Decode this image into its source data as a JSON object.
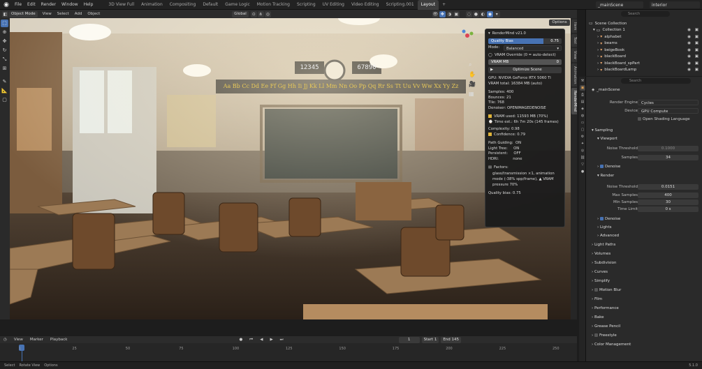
{
  "app": {
    "menu": [
      "File",
      "Edit",
      "Render",
      "Window",
      "Help"
    ],
    "workspaces": [
      "3D View Full",
      "Animation",
      "Compositing",
      "Default",
      "Game Logic",
      "Motion Tracking",
      "Scripting",
      "UV Editing",
      "Video Editing",
      "Scripting.001",
      "Layout"
    ],
    "active_workspace": "Layout",
    "scene_name": "_mainScene",
    "view_layer": "interior"
  },
  "viewport_header": {
    "mode": "Object Mode",
    "menus": [
      "View",
      "Select",
      "Add",
      "Object"
    ],
    "orientation": "Global",
    "options_label": "Options"
  },
  "scene_text": {
    "numbers_left": "12345",
    "numbers_right": "67890",
    "alphabet": "Aa Bb Cc Dd Ee Ff Gg Hh Ii Jj Kk Ll Mm Nn Oo Pp Qq Rr Ss Tt Uu Vv Ww Xx Yy Zz"
  },
  "right_tabs": [
    "Item",
    "Tool",
    "View",
    "Animation",
    "RenderMind"
  ],
  "rendermind": {
    "title": "RenderMind v21.0",
    "quality_label": "Quality Bias",
    "quality_value": "0.75",
    "quality_fraction": 0.75,
    "mode_label": "Mode:",
    "mode_value": "Balanced",
    "vram_override": "VRAM Override (0 = auto-detect)",
    "vram_mb_label": "VRAM MB",
    "vram_mb_value": "0",
    "optimize_label": "Optimize Scene",
    "gpu": "GPU: NVIDIA GeForce RTX 5060 Ti",
    "vram_total": "VRAM total: 16384 MB (auto)",
    "samples": "Samples: 400",
    "bounces": "Bounces: 21",
    "tile": "Tile: 768",
    "denoiser": "Denoiser: OPENIMAGEDENOISE",
    "vram_used": "VRAM used: 11593 MB  (70%)",
    "time_est": "Time est.: 6h 7m 20s  (145 frames)",
    "confidence": "Confidence: 0.79",
    "complexity": "Complexity: 0.98",
    "path_guiding": "Path Guiding:  ON",
    "light_tree": "Light Tree:     ON",
    "persistent": "Persistent:     OFF",
    "hdri": "HDRI:            none",
    "factors_label": "Factors:",
    "factors_text": "glass/transmission ×1, animation mode (-38% spp/frame), ▲ VRAM pressure 70%",
    "quality_footer": "Quality bias: 0.75",
    "colors": {
      "vram_used": "#e0b43a",
      "confidence": "#e0b43a"
    }
  },
  "timeline": {
    "menus": [
      "View",
      "Marker",
      "Playback"
    ],
    "current_frame": "1",
    "start_label": "Start",
    "start_value": "1",
    "end_label": "End",
    "end_value": "145",
    "ticks": [
      "1",
      "25",
      "50",
      "75",
      "100",
      "125",
      "150",
      "175",
      "200",
      "225",
      "250"
    ]
  },
  "status": {
    "items": [
      "Select",
      "Rotate View",
      "Options"
    ],
    "version": "5.1.0"
  },
  "outliner": {
    "search_placeholder": "Search",
    "root": "Scene Collection",
    "collection": "Collection 1",
    "items": [
      "alphabet",
      "beams",
      "beigeBook",
      "blackBoard",
      "blackBoard_spPart",
      "blackBoardLamp"
    ]
  },
  "properties": {
    "search_placeholder": "Search",
    "scene": "_mainScene",
    "render_engine_label": "Render Engine",
    "render_engine": "Cycles",
    "device_label": "Device",
    "device": "GPU Compute",
    "osl_label": "Open Shading Language",
    "sampling": "Sampling",
    "viewport": "Viewport",
    "noise_threshold_label": "Noise Threshold",
    "vp_noise_threshold": "0.1000",
    "samples_label": "Samples",
    "vp_samples": "34",
    "denoise": "Denoise",
    "render": "Render",
    "r_noise_threshold": "0.0151",
    "max_samples_label": "Max Samples",
    "max_samples": "400",
    "min_samples_label": "Min Samples",
    "min_samples": "30",
    "time_limit_label": "Time Limit",
    "time_limit": "0 s",
    "lights": "Lights",
    "advanced": "Advanced",
    "sections": [
      "Light Paths",
      "Volumes",
      "Subdivision",
      "Curves",
      "Simplify",
      "Motion Blur",
      "Film",
      "Performance",
      "Bake",
      "Grease Pencil",
      "Freestyle",
      "Color Management"
    ]
  }
}
